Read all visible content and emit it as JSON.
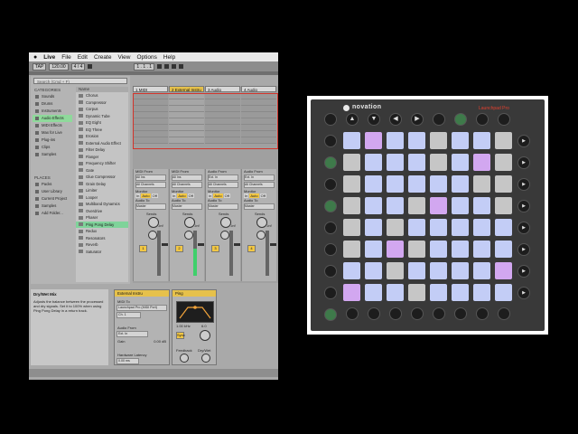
{
  "menubar": {
    "apple": "",
    "app_name": "Live",
    "items": [
      "File",
      "Edit",
      "Create",
      "View",
      "Options",
      "Help"
    ]
  },
  "transport": {
    "tap_label": "TAP",
    "tempo": "120.00",
    "meter": "4 / 4",
    "position": "1 . 1 . 1"
  },
  "browser": {
    "search_placeholder": "Search (Cmd + F)",
    "categories_header": "CATEGORIES",
    "categories": [
      {
        "label": "Sounds",
        "selected": false
      },
      {
        "label": "Drums",
        "selected": false
      },
      {
        "label": "Instruments",
        "selected": false
      },
      {
        "label": "Audio Effects",
        "selected": true
      },
      {
        "label": "MIDI Effects",
        "selected": false
      },
      {
        "label": "Max for Live",
        "selected": false
      },
      {
        "label": "Plug-ins",
        "selected": false
      },
      {
        "label": "Clips",
        "selected": false
      },
      {
        "label": "Samples",
        "selected": false
      }
    ],
    "places_header": "PLACES",
    "places": [
      "Packs",
      "User Library",
      "Current Project",
      "Samples",
      "Add Folder..."
    ],
    "name_header": "Name",
    "items": [
      {
        "label": "Chorus",
        "selected": false
      },
      {
        "label": "Compressor",
        "selected": false
      },
      {
        "label": "Corpus",
        "selected": false
      },
      {
        "label": "Dynamic Tube",
        "selected": false
      },
      {
        "label": "EQ Eight",
        "selected": false
      },
      {
        "label": "EQ Three",
        "selected": false
      },
      {
        "label": "Erosion",
        "selected": false
      },
      {
        "label": "External Audio Effect",
        "selected": false
      },
      {
        "label": "Filter Delay",
        "selected": false
      },
      {
        "label": "Flanger",
        "selected": false
      },
      {
        "label": "Frequency Shifter",
        "selected": false
      },
      {
        "label": "Gate",
        "selected": false
      },
      {
        "label": "Glue Compressor",
        "selected": false
      },
      {
        "label": "Grain Delay",
        "selected": false
      },
      {
        "label": "Limiter",
        "selected": false
      },
      {
        "label": "Looper",
        "selected": false
      },
      {
        "label": "Multiband Dynamics",
        "selected": false
      },
      {
        "label": "Overdrive",
        "selected": false
      },
      {
        "label": "Phaser",
        "selected": false
      },
      {
        "label": "Ping Pong Delay",
        "selected": true
      },
      {
        "label": "Redux",
        "selected": false
      },
      {
        "label": "Resonators",
        "selected": false
      },
      {
        "label": "Reverb",
        "selected": false
      },
      {
        "label": "Saturator",
        "selected": false
      }
    ]
  },
  "session": {
    "tracks": [
      {
        "name": "1 MIDI",
        "color": "#d8d8d8"
      },
      {
        "name": "2 External Instru",
        "color": "#e6c14b"
      },
      {
        "name": "3 Audio",
        "color": "#d8d8d8"
      },
      {
        "name": "4 Audio",
        "color": "#d8d8d8"
      }
    ],
    "io": {
      "midi_from": "MIDI From",
      "all_ins": "All Ins",
      "all_channels": "All Channels",
      "monitor": "Monitor",
      "audio_from": "Audio From",
      "ext_in": "Ext. In",
      "audio_to": "Audio To",
      "master": "Master",
      "in": "In",
      "auto": "Auto",
      "off": "Off"
    },
    "sends_label": "Sends",
    "track_numbers": [
      "1",
      "2",
      "3",
      "4"
    ],
    "level_readout": "-inf"
  },
  "info": {
    "title": "Dry/Wet Mix",
    "body": "Adjusts the balance between the processed and dry signals. Set it to 100% when using Ping Pong Delay in a return track."
  },
  "devices": {
    "external_instrument": {
      "title": "External Instru",
      "midi_to": "MIDI To",
      "midi_to_value": "Launchpad Pro (MIDI Port)",
      "channel": "Ch. 1",
      "audio_from": "Audio From",
      "audio_from_value": "Ext. In",
      "gain_label": "Gain",
      "gain_value": "0.00 dB",
      "latency_label": "Hardware Latency",
      "latency_value": "0.00 ms"
    },
    "ping_pong": {
      "title": "Ping",
      "sync_label": "Sync",
      "feedback_label": "Feedback",
      "freeze_label": "F",
      "drywet_label": "Dry/Wet",
      "freq_value": "1.00 kHz",
      "width_value": "6.0"
    }
  },
  "launchpad": {
    "brand": "novation",
    "model": "Launchpad Pro",
    "top_buttons": [
      "",
      "▲",
      "▼",
      "◀",
      "▶",
      "",
      "",
      "",
      ""
    ],
    "top_green": [
      false,
      false,
      false,
      false,
      false,
      false,
      true,
      false,
      false
    ],
    "left_green": [
      false,
      true,
      false,
      true,
      false,
      false,
      false,
      false,
      true
    ],
    "right_buttons": [
      "▶",
      "▶",
      "▶",
      "▶",
      "▶",
      "▶",
      "▶",
      "▶"
    ],
    "colors": {
      "w": "#e9eeff",
      "b": "#c3cdf6",
      "d": "#c6c6c6",
      "p": "#d2a7f0"
    },
    "grid": [
      [
        "b",
        "p",
        "b",
        "b",
        "d",
        "b",
        "b",
        "d"
      ],
      [
        "d",
        "b",
        "b",
        "b",
        "d",
        "b",
        "p",
        "d"
      ],
      [
        "d",
        "b",
        "b",
        "b",
        "b",
        "b",
        "d",
        "d"
      ],
      [
        "d",
        "b",
        "b",
        "d",
        "p",
        "b",
        "b",
        "d"
      ],
      [
        "d",
        "b",
        "d",
        "b",
        "b",
        "b",
        "b",
        "b"
      ],
      [
        "d",
        "b",
        "p",
        "d",
        "b",
        "b",
        "b",
        "b"
      ],
      [
        "b",
        "b",
        "d",
        "b",
        "b",
        "b",
        "b",
        "p"
      ],
      [
        "p",
        "b",
        "b",
        "d",
        "b",
        "b",
        "b",
        "b"
      ]
    ]
  }
}
